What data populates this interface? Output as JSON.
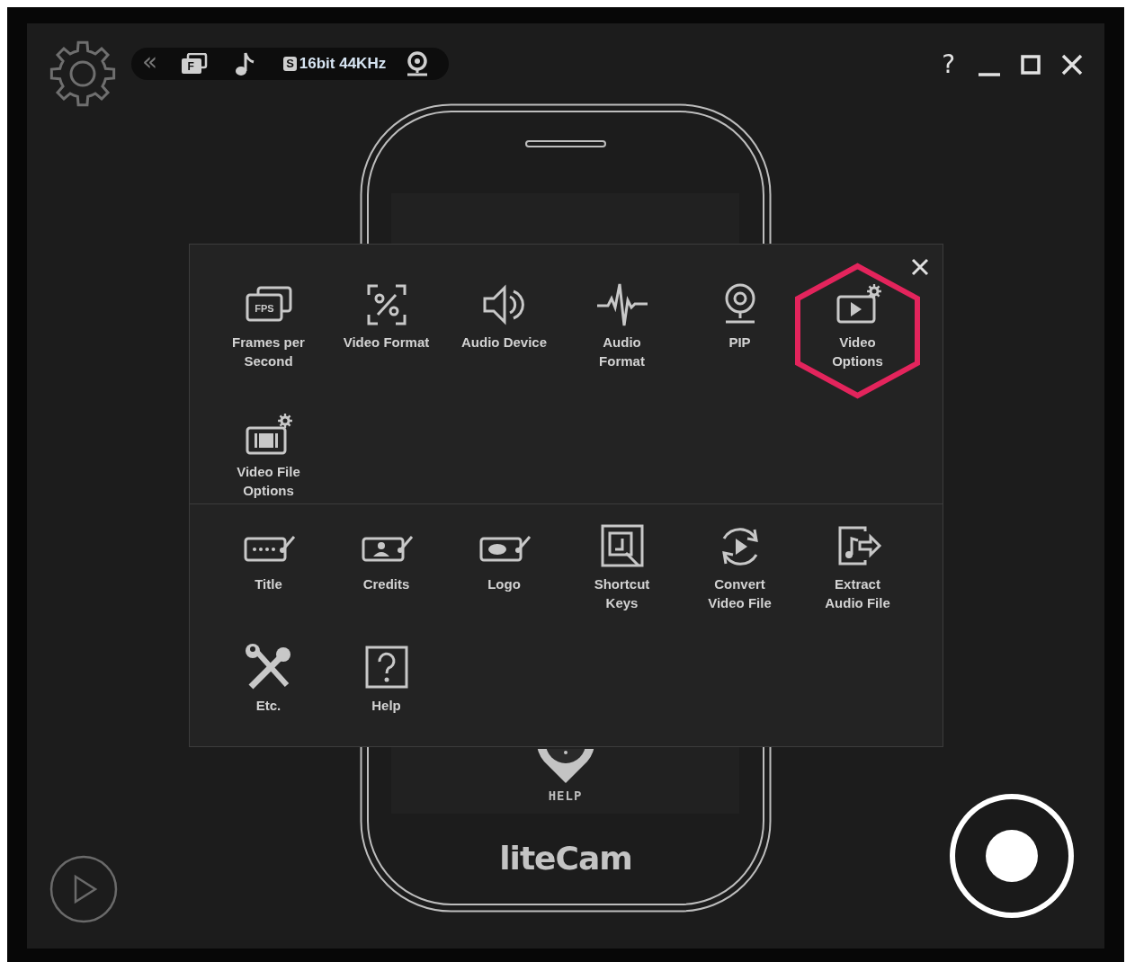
{
  "toolbar": {
    "collapse_glyph": "«",
    "format_badge": "F",
    "sample_badge": "S",
    "audio_format": "16bit 44KHz"
  },
  "window_controls": {
    "help": "?"
  },
  "phone": {
    "help_label": "HELP",
    "logo": "liteCam"
  },
  "menu": {
    "groups": [
      {
        "items": [
          {
            "kind": "fps",
            "badge": "FPS",
            "label": "Frames per Second",
            "selected": false
          },
          {
            "kind": "video_format",
            "label": "Video Format",
            "selected": false
          },
          {
            "kind": "audio_device",
            "label": "Audio Device",
            "selected": false
          },
          {
            "kind": "audio_format",
            "label": "Audio Format",
            "selected": false
          },
          {
            "kind": "pip",
            "label": "PIP",
            "selected": false
          },
          {
            "kind": "video_options",
            "label": "Video Options",
            "selected": true
          },
          {
            "kind": "video_file_options",
            "label": "Video File Options",
            "selected": false
          }
        ]
      },
      {
        "items": [
          {
            "kind": "title",
            "label": "Title",
            "selected": false
          },
          {
            "kind": "credits",
            "label": "Credits",
            "selected": false
          },
          {
            "kind": "logo",
            "label": "Logo",
            "selected": false
          },
          {
            "kind": "shortcut",
            "label": "Shortcut Keys",
            "selected": false
          },
          {
            "kind": "convert",
            "label": "Convert Video File",
            "selected": false
          },
          {
            "kind": "extract",
            "label": "Extract Audio File",
            "selected": false
          },
          {
            "kind": "etc",
            "label": "Etc.",
            "selected": false
          },
          {
            "kind": "help",
            "label": "Help",
            "selected": false
          }
        ]
      }
    ]
  }
}
